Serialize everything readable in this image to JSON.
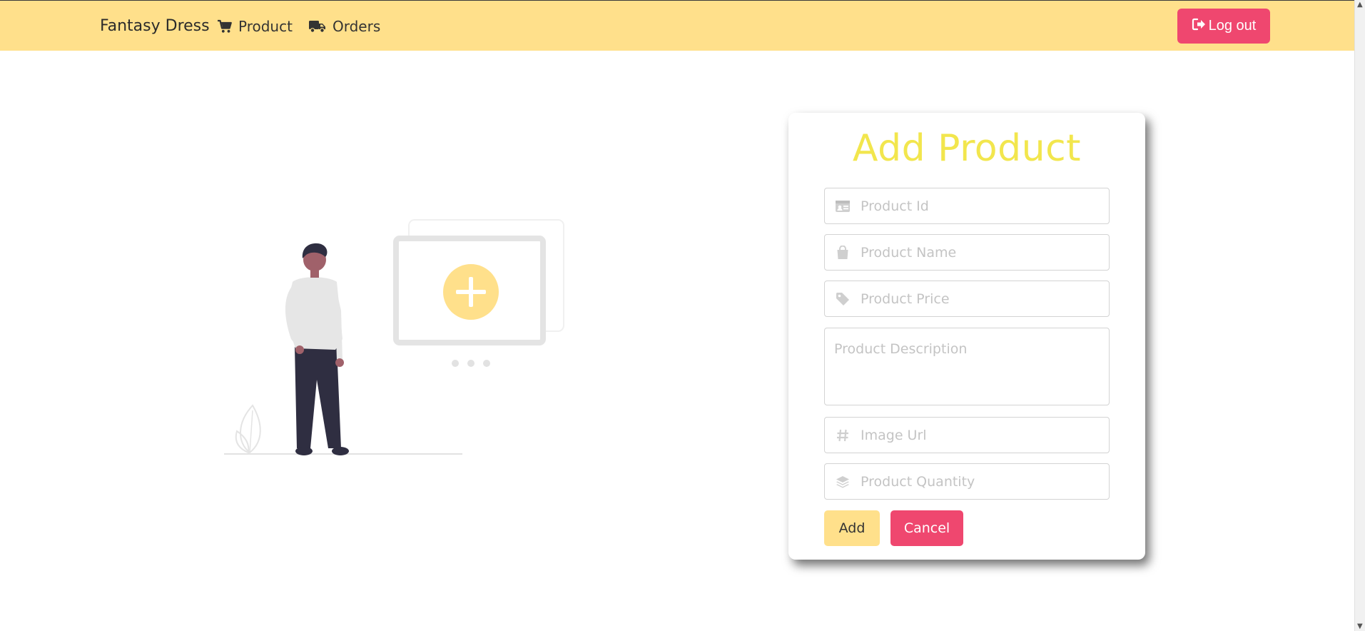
{
  "navbar": {
    "brand": "Fantasy Dress",
    "items": [
      {
        "label": "Product",
        "icon": "shopping-cart-icon"
      },
      {
        "label": "Orders",
        "icon": "truck-icon"
      }
    ],
    "logout_label": "Log out",
    "logout_icon": "sign-out-icon"
  },
  "form": {
    "title": "Add Product",
    "fields": {
      "product_id": {
        "placeholder": "Product Id",
        "value": "",
        "icon": "id-card-icon"
      },
      "product_name": {
        "placeholder": "Product Name",
        "value": "",
        "icon": "shopping-bag-icon"
      },
      "product_price": {
        "placeholder": "Product Price",
        "value": "",
        "icon": "tag-icon"
      },
      "product_description": {
        "placeholder": "Product Description",
        "value": ""
      },
      "image_url": {
        "placeholder": "Image Url",
        "value": "",
        "icon": "hashtag-icon"
      },
      "product_quantity": {
        "placeholder": "Product Quantity",
        "value": "",
        "icon": "layers-icon"
      }
    },
    "add_label": "Add",
    "cancel_label": "Cancel"
  },
  "colors": {
    "navbar_bg": "#ffe08b",
    "accent_pink": "#ef476f",
    "title_yellow": "#f2e64d",
    "add_button": "#ffe08b"
  }
}
